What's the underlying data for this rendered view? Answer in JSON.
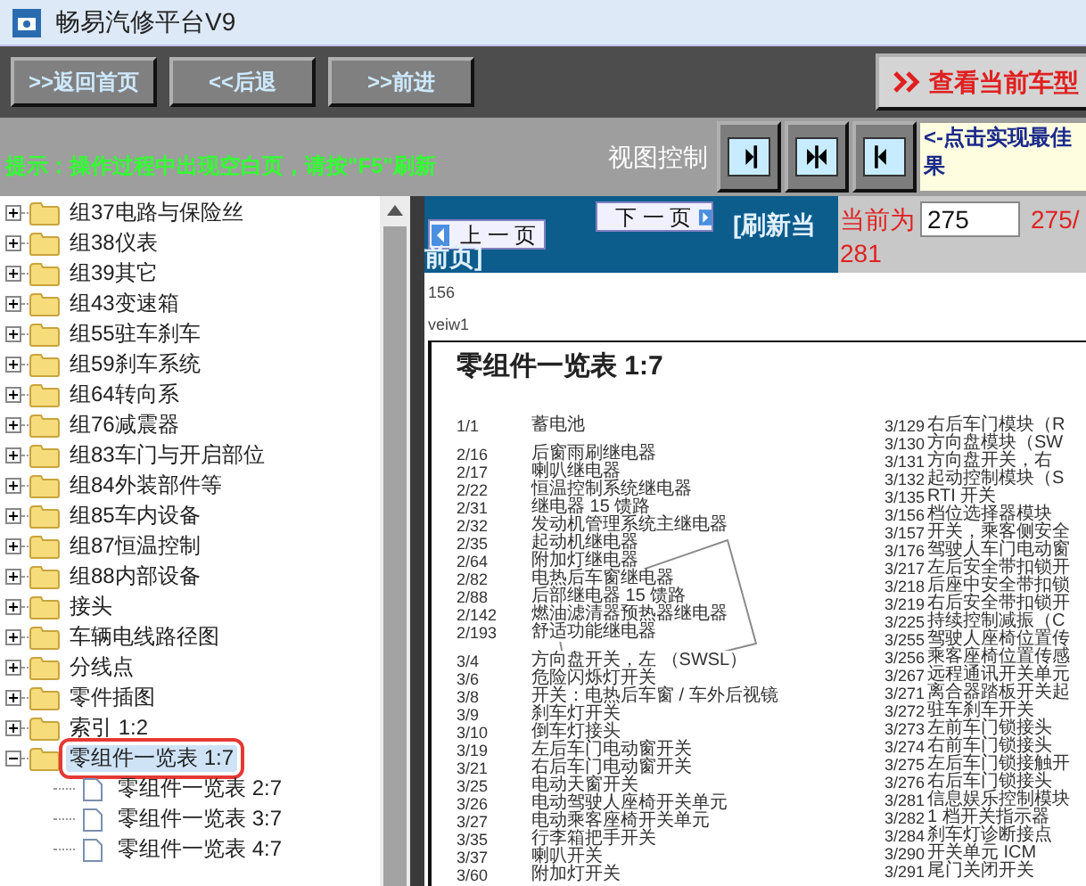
{
  "window": {
    "title": "畅易汽修平台V9"
  },
  "nav_buttons": [
    ">>返回首页",
    "<<后退",
    ">>前进"
  ],
  "vehicle_button": "查看当前车型",
  "hint": "提示：操作过程中出现空白页，请按\"F5\"刷新",
  "view_control": {
    "label": "视图控制",
    "buttons": [
      {
        "kind": "right"
      },
      {
        "kind": "both"
      },
      {
        "kind": "left"
      }
    ],
    "note_lines": [
      "<-点击实现最佳",
      "果"
    ]
  },
  "tree": {
    "items": [
      {
        "label": "组37电路与保险丝",
        "expanded": false,
        "selected": false
      },
      {
        "label": "组38仪表",
        "expanded": false,
        "selected": false
      },
      {
        "label": "组39其它",
        "expanded": false,
        "selected": false
      },
      {
        "label": "组43变速箱",
        "expanded": false,
        "selected": false
      },
      {
        "label": "组55驻车刹车",
        "expanded": false,
        "selected": false
      },
      {
        "label": "组59刹车系统",
        "expanded": false,
        "selected": false
      },
      {
        "label": "组64转向系",
        "expanded": false,
        "selected": false
      },
      {
        "label": "组76减震器",
        "expanded": false,
        "selected": false
      },
      {
        "label": "组83车门与开启部位",
        "expanded": false,
        "selected": false
      },
      {
        "label": "组84外装部件等",
        "expanded": false,
        "selected": false
      },
      {
        "label": "组85车内设备",
        "expanded": false,
        "selected": false
      },
      {
        "label": "组87恒温控制",
        "expanded": false,
        "selected": false
      },
      {
        "label": "组88内部设备",
        "expanded": false,
        "selected": false
      },
      {
        "label": "接头",
        "expanded": false,
        "selected": false
      },
      {
        "label": "车辆电线路径图",
        "expanded": false,
        "selected": false
      },
      {
        "label": "分线点",
        "expanded": false,
        "selected": false
      },
      {
        "label": "零件插图",
        "expanded": false,
        "selected": false
      },
      {
        "label": "索引 1:2",
        "expanded": false,
        "selected": false
      },
      {
        "label": "零组件一览表 1:7",
        "expanded": true,
        "selected": true,
        "children": [
          {
            "label": "零组件一览表 2:7",
            "selected": false
          },
          {
            "label": "零组件一览表 3:7",
            "selected": false
          },
          {
            "label": "零组件一览表 4:7",
            "selected": false
          }
        ]
      }
    ]
  },
  "pager": {
    "prev": "上 一 页",
    "next": "下 一 页",
    "refresh_lines": [
      "[刷新当",
      "前页]"
    ],
    "current_label": "当前为",
    "current_value": "275",
    "total_lines": [
      "275/",
      "281"
    ]
  },
  "debug_lines": [
    "156",
    "veiw1"
  ],
  "document": {
    "title": "零组件一览表 1:7",
    "left_groups": [
      [
        {
          "code": "1/1",
          "name": "蓄电池"
        }
      ],
      [
        {
          "code": "2/16",
          "name": "后窗雨刷继电器"
        },
        {
          "code": "2/17",
          "name": "喇叭继电器"
        },
        {
          "code": "2/22",
          "name": "恒温控制系统继电器"
        },
        {
          "code": "2/31",
          "name": "继电器 15 馈路"
        },
        {
          "code": "2/32",
          "name": "发动机管理系统主继电器"
        },
        {
          "code": "2/35",
          "name": "起动机继电器"
        },
        {
          "code": "2/64",
          "name": "附加灯继电器"
        },
        {
          "code": "2/82",
          "name": "电热后车窗继电器"
        },
        {
          "code": "2/88",
          "name": "后部继电器 15 馈路"
        },
        {
          "code": "2/142",
          "name": "燃油滤清器预热器继电器"
        },
        {
          "code": "2/193",
          "name": "舒适功能继电器"
        }
      ],
      [
        {
          "code": "3/4",
          "name": "方向盘开关，左 （SWSL）"
        },
        {
          "code": "3/6",
          "name": "危险闪烁灯开关"
        },
        {
          "code": "3/8",
          "name": "开关：电热后车窗 / 车外后视镜"
        },
        {
          "code": "3/9",
          "name": "刹车灯开关"
        },
        {
          "code": "3/10",
          "name": "倒车灯接头"
        },
        {
          "code": "3/19",
          "name": "左后车门电动窗开关"
        },
        {
          "code": "3/21",
          "name": "右后车门电动窗开关"
        },
        {
          "code": "3/25",
          "name": "电动天窗开关"
        },
        {
          "code": "3/26",
          "name": "电动驾驶人座椅开关单元"
        },
        {
          "code": "3/27",
          "name": "电动乘客座椅开关单元"
        },
        {
          "code": "3/35",
          "name": "行李箱把手开关"
        },
        {
          "code": "3/37",
          "name": "喇叭开关"
        },
        {
          "code": "3/60",
          "name": "附加灯开关"
        }
      ]
    ],
    "right_groups": [
      [
        {
          "code": "3/129",
          "name": "右后车门模块（R"
        },
        {
          "code": "3/130",
          "name": "方向盘模块（SW"
        },
        {
          "code": "3/131",
          "name": "方向盘开关，右"
        },
        {
          "code": "3/132",
          "name": "起动控制模块（S"
        },
        {
          "code": "3/135",
          "name": "RTI 开关"
        },
        {
          "code": "3/156",
          "name": "档位选择器模块"
        },
        {
          "code": "3/157",
          "name": "开关，乘客侧安全"
        },
        {
          "code": "3/176",
          "name": "驾驶人车门电动窗"
        },
        {
          "code": "3/217",
          "name": "左后安全带扣锁开"
        },
        {
          "code": "3/218",
          "name": "后座中安全带扣锁"
        },
        {
          "code": "3/219",
          "name": "右后安全带扣锁开"
        },
        {
          "code": "3/225",
          "name": "持续控制减振（C"
        },
        {
          "code": "3/255",
          "name": "驾驶人座椅位置传"
        },
        {
          "code": "3/256",
          "name": "乘客座椅位置传感"
        },
        {
          "code": "3/267",
          "name": "远程通讯开关单元"
        },
        {
          "code": "3/271",
          "name": "离合器踏板开关起"
        },
        {
          "code": "3/272",
          "name": "驻车刹车开关"
        },
        {
          "code": "3/273",
          "name": "左前车门锁接头"
        },
        {
          "code": "3/274",
          "name": "右前车门锁接头"
        },
        {
          "code": "3/275",
          "name": "左后车门锁接触开"
        },
        {
          "code": "3/276",
          "name": "右后车门锁接头"
        },
        {
          "code": "3/281",
          "name": "信息娱乐控制模块"
        },
        {
          "code": "3/282",
          "name": "1 档开关指示器"
        },
        {
          "code": "3/284",
          "name": "刹车灯诊断接点"
        },
        {
          "code": "3/290",
          "name": "开关单元 ICM"
        },
        {
          "code": "3/291",
          "name": "尾门关闭开关"
        }
      ]
    ]
  }
}
